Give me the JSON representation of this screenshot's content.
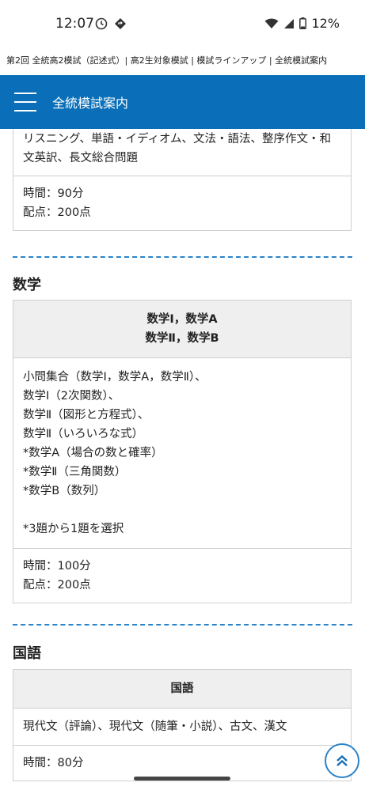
{
  "status": {
    "time": "12:07",
    "battery": "12%"
  },
  "page_title": "第2回 全統高2模試（記述式）| 高2生対象模試 | 模試ラインアップ | 全統模試案内",
  "header": {
    "title": "全統模試案内"
  },
  "english_card": {
    "content": "リスニング、単語・イディオム、文法・語法、整序作文・和文英訳、長文総合問題",
    "time": "時間：90分",
    "score": "配点：200点"
  },
  "math": {
    "section_title": "数学",
    "head_line1": "数学Ⅰ，数学A",
    "head_line2": "数学Ⅱ，数学B",
    "content_lines": [
      "小問集合（数学Ⅰ，数学A，数学Ⅱ）、",
      "数学Ⅰ（2次関数）、",
      "数学Ⅱ（図形と方程式）、",
      "数学Ⅱ（いろいろな式）",
      "*数学A（場合の数と確率）",
      "*数学Ⅱ（三角関数）",
      "*数学B（数列）",
      "",
      "*3題から1題を選択"
    ],
    "time": "時間：100分",
    "score": "配点：200点"
  },
  "japanese": {
    "section_title": "国語",
    "head": "国語",
    "content": "現代文（評論）、現代文（随筆・小説）、古文、漢文",
    "time": "時間：80分"
  }
}
